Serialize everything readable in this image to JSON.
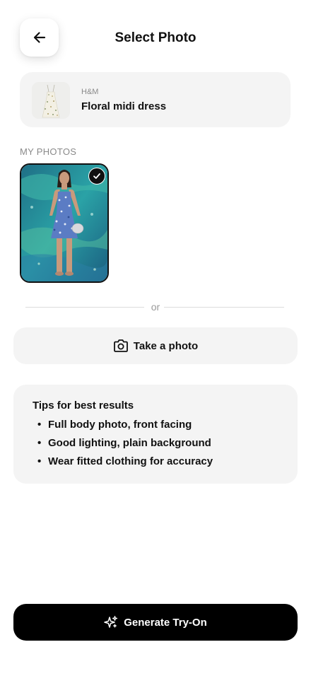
{
  "header": {
    "title": "Select Photo",
    "back_icon": "arrow-left-icon"
  },
  "product": {
    "brand": "H&M",
    "name": "Floral midi dress"
  },
  "photos_section": {
    "label": "MY PHOTOS",
    "photos": [
      {
        "selected": true,
        "check_icon": "check-icon"
      }
    ]
  },
  "divider": {
    "text": "or"
  },
  "take_photo": {
    "label": "Take a photo",
    "icon": "camera-icon"
  },
  "tips": {
    "title": "Tips for best results",
    "items": [
      "Full body photo, front facing",
      "Good lighting, plain background",
      "Wear fitted clothing for accuracy"
    ]
  },
  "generate": {
    "label": "Generate Try-On",
    "icon": "sparkles-icon"
  },
  "colors": {
    "accent": "#000000",
    "card_bg": "#f4f4f4",
    "muted_text": "#8a8a8a"
  }
}
